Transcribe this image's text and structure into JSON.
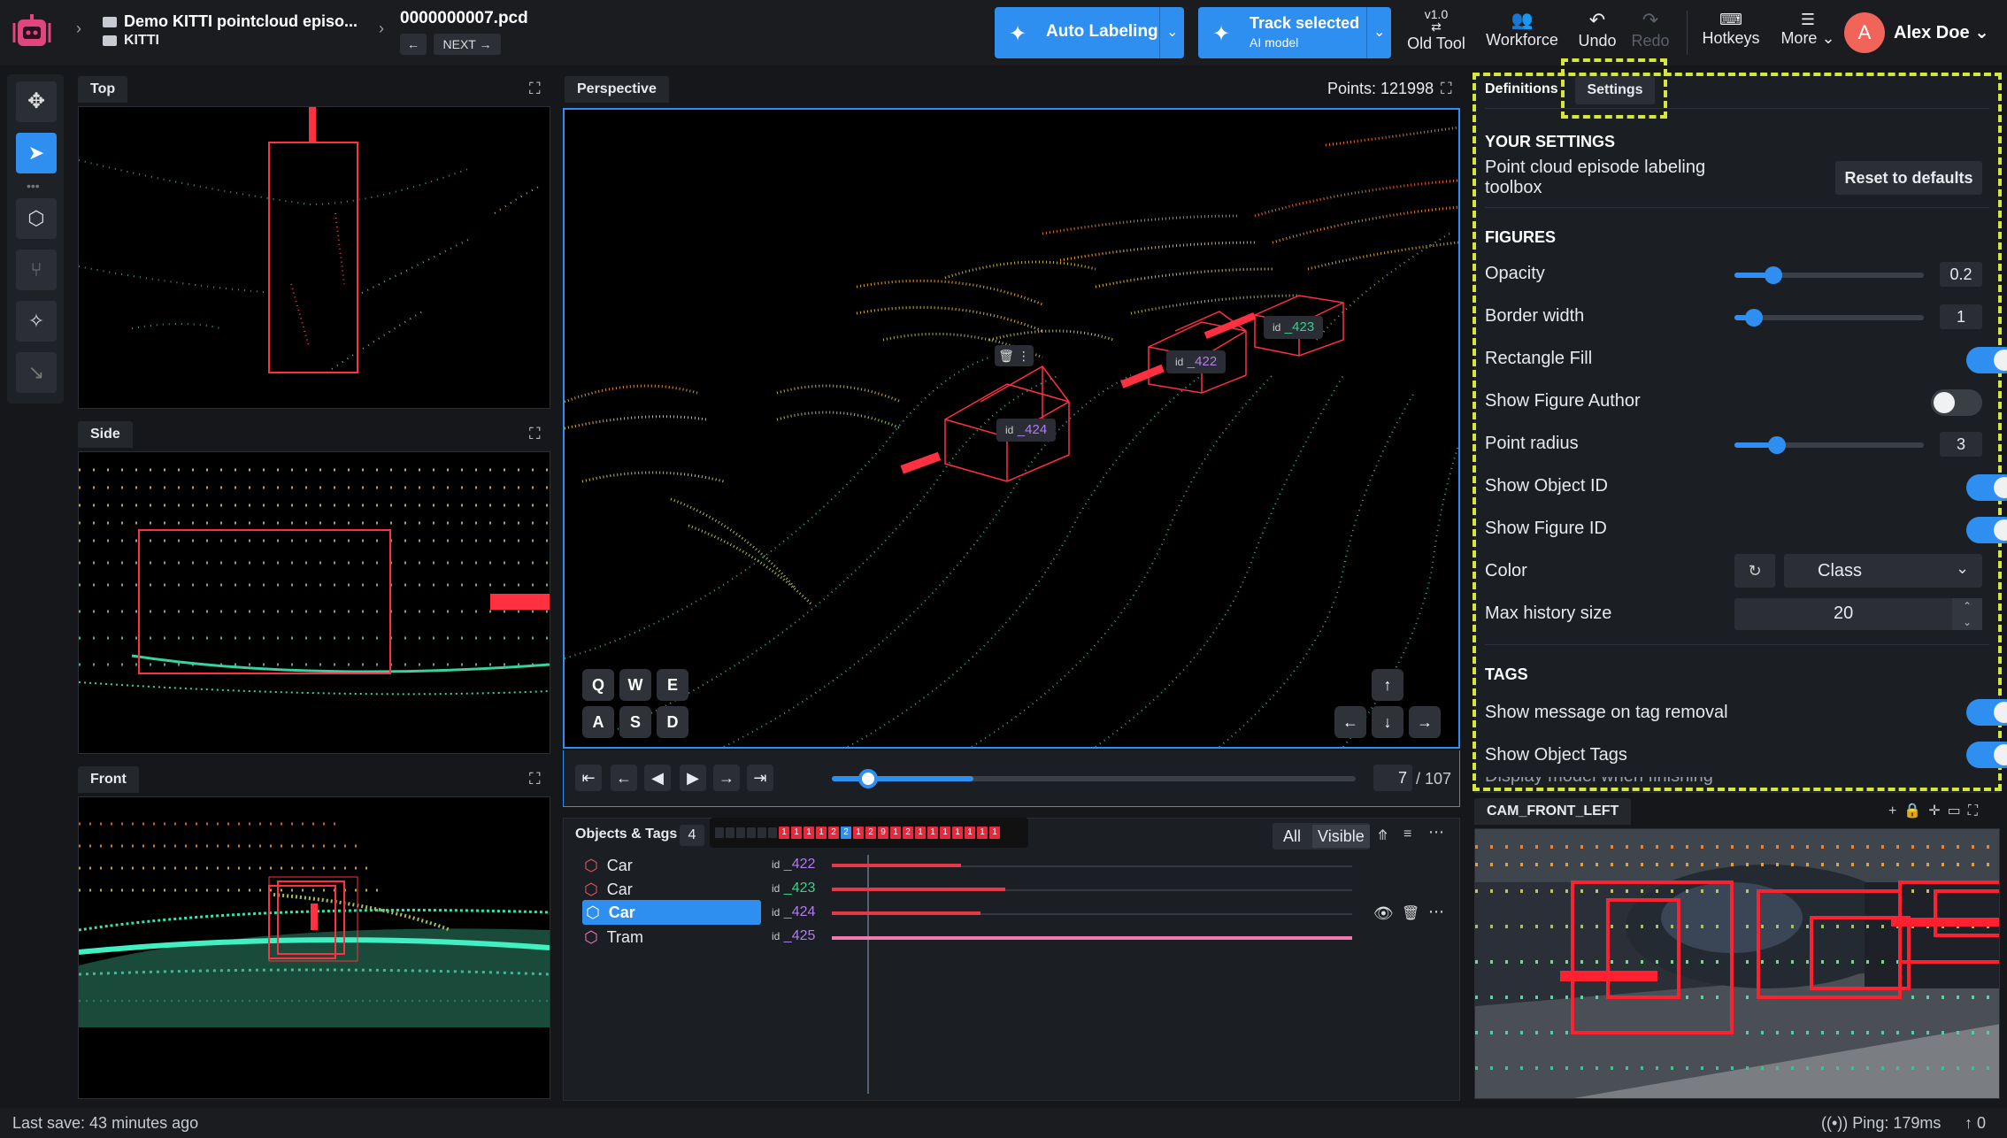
{
  "header": {
    "project_title": "Demo KITTI pointcloud episo...",
    "dataset": "KITTI",
    "file_name": "0000000007.pcd",
    "next_label": "NEXT",
    "auto_labeling": "Auto Labeling",
    "track_selected": "Track selected",
    "track_selected_sub": "AI model",
    "old_tool_version": "v1.0",
    "old_tool": "Old Tool",
    "workforce": "Workforce",
    "undo": "Undo",
    "redo": "Redo",
    "hotkeys": "Hotkeys",
    "more": "More",
    "avatar_initial": "A",
    "user_name": "Alex Doe"
  },
  "views": {
    "top": "Top",
    "side": "Side",
    "front": "Front",
    "perspective": "Perspective",
    "points": "Points: 121998",
    "camera": "CAM_FRONT_LEFT"
  },
  "keys": [
    "Q",
    "W",
    "E",
    "A",
    "S",
    "D"
  ],
  "figure_labels": {
    "id_prefix": "id",
    "f424": "_424",
    "f422": "_422",
    "f423": "_423"
  },
  "playback": {
    "current_frame": "7",
    "total_frames": "/ 107",
    "progress": 0.27
  },
  "objects": {
    "title": "Objects & Tags",
    "count": "4",
    "filter_all": "All",
    "filter_visible": "Visible",
    "items": [
      {
        "cls": "Car",
        "id": "_422",
        "color": "#e8566a",
        "idcolor": "#b07cf0"
      },
      {
        "cls": "Car",
        "id": "_423",
        "color": "#e8566a",
        "idcolor": "#3ad08a"
      },
      {
        "cls": "Car",
        "id": "_424",
        "color": "#e8566a",
        "idcolor": "#b07cf0"
      },
      {
        "cls": "Tram",
        "id": "_425",
        "color": "#f07ab0",
        "idcolor": "#b07cf0"
      }
    ],
    "frame_strip": [
      "1",
      "1",
      "1",
      "1",
      "2",
      "2",
      "1",
      "2",
      "9",
      "1",
      "2",
      "1",
      "1",
      "1",
      "1",
      "1",
      "1",
      "1"
    ]
  },
  "settings": {
    "tab_definitions": "Definitions",
    "tab_settings": "Settings",
    "your_settings": "YOUR SETTINGS",
    "description": "Point cloud episode labeling toolbox",
    "reset": "Reset to defaults",
    "figures": "FIGURES",
    "opacity_label": "Opacity",
    "opacity_value": "0.2",
    "border_label": "Border width",
    "border_value": "1",
    "rect_fill": "Rectangle Fill",
    "show_author": "Show Figure Author",
    "point_radius_label": "Point radius",
    "point_radius_value": "3",
    "show_object_id": "Show Object ID",
    "show_figure_id": "Show Figure ID",
    "color_label": "Color",
    "color_value": "Class",
    "history_label": "Max history size",
    "history_value": "20",
    "tags": "TAGS",
    "tag_removal": "Show message on tag removal",
    "object_tags": "Show Object Tags",
    "cut_off": "Display model when finishing"
  },
  "status": {
    "last_save": "Last save: 43 minutes ago",
    "ping": "Ping: 179ms",
    "upload": "0"
  }
}
